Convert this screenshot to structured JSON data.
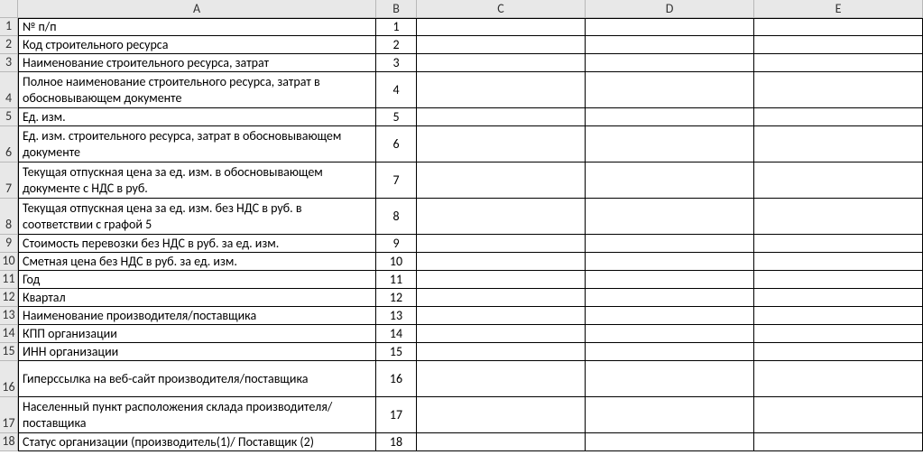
{
  "columns": [
    "A",
    "B",
    "C",
    "D",
    "E"
  ],
  "rows": [
    {
      "num": "1",
      "a": "№ п/п",
      "b": "1",
      "lines": 1
    },
    {
      "num": "2",
      "a": "Код строительного ресурса",
      "b": "2",
      "lines": 1
    },
    {
      "num": "3",
      "a": "Наименование строительного ресурса, затрат",
      "b": "3",
      "lines": 1
    },
    {
      "num": "4",
      "a": "Полное наименование строительного ресурса, затрат в обосновывающем документе",
      "b": "4",
      "lines": 2
    },
    {
      "num": "5",
      "a": "Ед. изм.",
      "b": "5",
      "lines": 1
    },
    {
      "num": "6",
      "a": "Ед. изм. строительного ресурса, затрат в обосновывающем документе",
      "b": "6",
      "lines": 2
    },
    {
      "num": "7",
      "a": "Текущая отпускная цена за ед. изм. в обосновывающем документе с НДС в руб.",
      "b": "7",
      "lines": 2
    },
    {
      "num": "8",
      "a": "Текущая отпускная цена за ед. изм. без НДС в руб. в соответствии с графой 5",
      "b": "8",
      "lines": 2
    },
    {
      "num": "9",
      "a": "Стоимость перевозки без НДС в руб. за ед. изм.",
      "b": "9",
      "lines": 1
    },
    {
      "num": "10",
      "a": "Сметная цена без НДС в руб. за ед. изм.",
      "b": "10",
      "lines": 1
    },
    {
      "num": "11",
      "a": "Год",
      "b": "11",
      "lines": 1
    },
    {
      "num": "12",
      "a": "Квартал",
      "b": "12",
      "lines": 1
    },
    {
      "num": "13",
      "a": "Наименование производителя/поставщика",
      "b": "13",
      "lines": 1
    },
    {
      "num": "14",
      "a": "КПП организации",
      "b": "14",
      "lines": 1
    },
    {
      "num": "15",
      "a": "ИНН организации",
      "b": "15",
      "lines": 1
    },
    {
      "num": "16",
      "a": "Гиперссылка на веб-сайт производителя/поставщика",
      "b": "16",
      "lines": 2
    },
    {
      "num": "17",
      "a": "Населенный пункт расположения склада производителя/поставщика",
      "b": "17",
      "lines": 2
    },
    {
      "num": "18",
      "a": "Статус организации (производитель(1)/ Поставщик (2)",
      "b": "18",
      "lines": 1
    }
  ]
}
